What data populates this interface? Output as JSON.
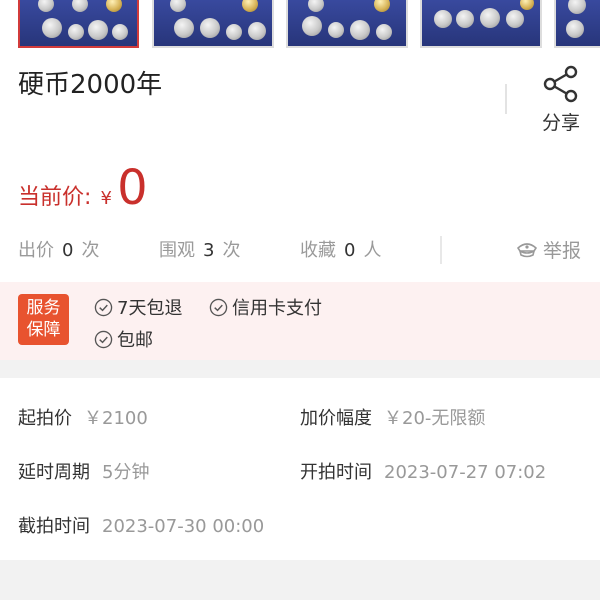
{
  "product": {
    "title": "硬币2000年"
  },
  "share": {
    "label": "分享",
    "icon": "share-icon"
  },
  "price": {
    "label": "当前价:",
    "currency": "¥",
    "value": "0",
    "color": "#c9302c"
  },
  "stats": {
    "bids": {
      "label": "出价",
      "count": "0",
      "unit": "次"
    },
    "views": {
      "label": "围观",
      "count": "3",
      "unit": "次"
    },
    "favorites": {
      "label": "收藏",
      "count": "0",
      "unit": "人"
    }
  },
  "report": {
    "label": "举报",
    "icon": "police-cap-icon"
  },
  "service": {
    "badge": [
      "服务",
      "保障"
    ],
    "badge_color": "#e8532f",
    "items": [
      "7天包退",
      "信用卡支付",
      "包邮"
    ]
  },
  "details": {
    "start_price": {
      "label": "起拍价",
      "value": "￥2100"
    },
    "increment": {
      "label": "加价幅度",
      "value": "￥20-无限额"
    },
    "delay": {
      "label": "延时周期",
      "value": "5分钟"
    },
    "start_time": {
      "label": "开拍时间",
      "value": "2023-07-27 07:02"
    },
    "end_time": {
      "label": "截拍时间",
      "value": "2023-07-30 00:00"
    }
  }
}
